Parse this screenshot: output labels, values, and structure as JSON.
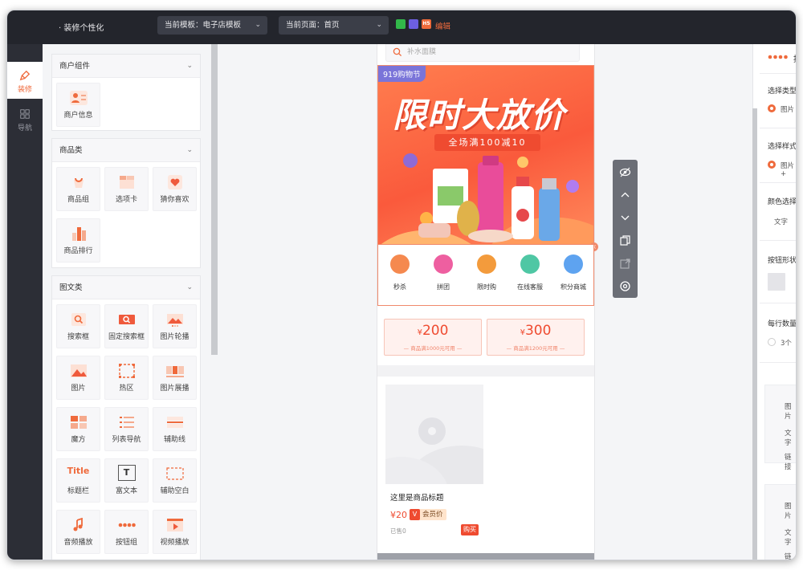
{
  "topbar": {
    "title": "· 装修个性化",
    "template_select": "当前模板：电子店模板",
    "page_select": "当前页面：首页",
    "edit_label": "编辑",
    "h5_label": "H5"
  },
  "rail": [
    {
      "label": "装修",
      "active": true
    },
    {
      "label": "导航",
      "active": false
    }
  ],
  "groups": {
    "merchant": {
      "title": "商户组件",
      "items": [
        "商户信息"
      ]
    },
    "goods": {
      "title": "商品类",
      "items": [
        "商品组",
        "选项卡",
        "猜你喜欢",
        "商品排行"
      ]
    },
    "media": {
      "title": "图文类",
      "items": [
        "搜索框",
        "固定搜索框",
        "图片轮播",
        "图片",
        "热区",
        "图片展播",
        "魔方",
        "列表导航",
        "辅助线",
        "标题栏",
        "富文本",
        "辅助空白",
        "音频播放",
        "按钮组",
        "视频播放"
      ]
    }
  },
  "icon_labels": {
    "title_tile": "Title",
    "richtext_tile": "T"
  },
  "preview": {
    "search_placeholder": "补水面膜",
    "banner_tag": "919购物节",
    "banner_title": "限时大放价",
    "banner_subtitle": "全场满100减10",
    "quick_nav": [
      {
        "label": "秒杀",
        "color": "#f5894f"
      },
      {
        "label": "拼团",
        "color": "#ee5fa0"
      },
      {
        "label": "限时购",
        "color": "#f39b3c"
      },
      {
        "label": "在线客服",
        "color": "#4fc7a4"
      },
      {
        "label": "积分商城",
        "color": "#5ea3f0"
      }
    ],
    "coupons": [
      {
        "currency": "¥",
        "amount": "200",
        "condition": "— 商品满1000元可用 —"
      },
      {
        "currency": "¥",
        "amount": "300",
        "condition": "— 商品满1200元可用 —"
      }
    ],
    "product": {
      "title": "这里是商品标题",
      "price": "¥20",
      "vip_mark": "V",
      "vip_label": "会员价",
      "sold": "已售0",
      "buy_label": "购买"
    }
  },
  "right_panel": {
    "tab_label": "按",
    "sections": [
      {
        "label": "选择类型",
        "option": "图片"
      },
      {
        "label": "选择样式",
        "option": "图片+"
      },
      {
        "label": "颜色选择",
        "option": "文字"
      },
      {
        "label": "按钮形状",
        "option": ""
      },
      {
        "label": "每行数量",
        "option": "3个"
      }
    ],
    "block_rows": [
      "图片",
      "文字",
      "链接"
    ]
  },
  "colors": {
    "accent": "#ef6a3c",
    "topbar": "#23252c",
    "rail": "#2c2e36"
  }
}
